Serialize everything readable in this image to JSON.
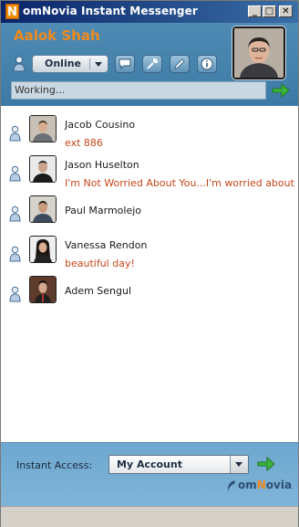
{
  "window": {
    "title": "omNovia Instant Messenger",
    "logo_letter": "N",
    "controls": {
      "minimize": "_",
      "maximize": "□",
      "close": "✕"
    }
  },
  "header": {
    "user_name": "Aalok Shah",
    "status": "Online",
    "status_message": "Working..."
  },
  "contacts": [
    {
      "name": "Jacob Cousino",
      "message": "ext 886"
    },
    {
      "name": "Jason Huselton",
      "message": "I'm Not Worried About You...I'm worried about"
    },
    {
      "name": "Paul Marmolejo",
      "message": ""
    },
    {
      "name": "Vanessa Rendon",
      "message": "beautiful day!"
    },
    {
      "name": "Adem Sengul",
      "message": ""
    }
  ],
  "footer": {
    "instant_access_label": "Instant Access:",
    "instant_access_value": "My Account",
    "brand_prefix": "om",
    "brand_accent": "N",
    "brand_suffix": "ovia"
  },
  "colors": {
    "accent": "#f08a1c",
    "header_bg": "#4f8bb4",
    "message_text": "#c8461a",
    "footer_bg": "#7fb4d8"
  }
}
